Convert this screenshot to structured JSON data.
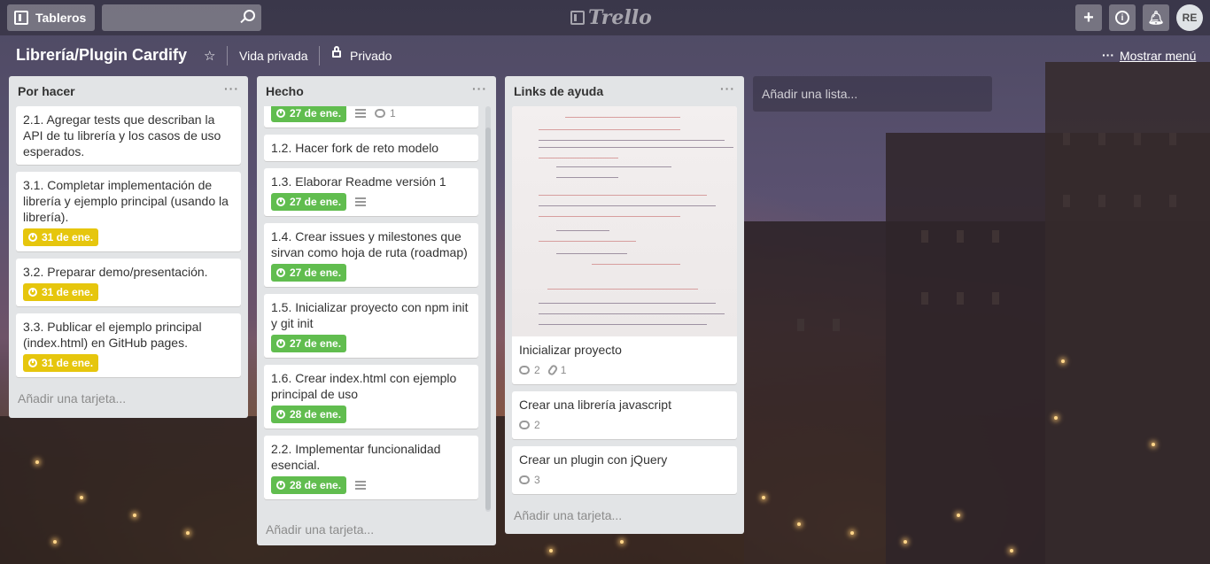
{
  "header": {
    "boards_label": "Tableros",
    "search_placeholder": "",
    "logo": "Trello",
    "avatar_initials": "RE"
  },
  "board": {
    "title": "Librería/Plugin Cardify",
    "visibility_team": "Vida privada",
    "visibility": "Privado",
    "menu_label": "Mostrar menú"
  },
  "colors": {
    "due_yellow": "#e6c60d",
    "due_green": "#61bd4f",
    "list_bg": "#e2e4e6"
  },
  "lists": [
    {
      "title": "Por hacer",
      "add_card": "Añadir una tarjeta...",
      "cards": [
        {
          "title": "2.1. Agregar tests que describan la API de tu librería y los casos de uso esperados."
        },
        {
          "title": "3.1. Completar implementación de librería y ejemplo principal (usando la librería).",
          "due": "31 de ene."
        },
        {
          "title": "3.2. Preparar demo/presentación.",
          "due": "31 de ene."
        },
        {
          "title": "3.3. Publicar el ejemplo principal (index.html) en GitHub pages.",
          "due": "31 de ene."
        }
      ]
    },
    {
      "title": "Hecho",
      "add_card": "Añadir una tarjeta...",
      "cards": [
        {
          "due": "27 de ene.",
          "comments": "1"
        },
        {
          "title": "1.2. Hacer fork de reto modelo"
        },
        {
          "title": "1.3. Elaborar Readme versión 1",
          "due": "27 de ene."
        },
        {
          "title": "1.4. Crear issues y milestones que sirvan como hoja de ruta (roadmap)",
          "due": "27 de ene."
        },
        {
          "title": "1.5. Inicializar proyecto con npm init y git init",
          "due": "27 de ene."
        },
        {
          "title": "1.6. Crear index.html con ejemplo principal de uso",
          "due": "28 de ene."
        },
        {
          "title": "2.2. Implementar funcionalidad esencial.",
          "due": "28 de ene."
        }
      ]
    },
    {
      "title": "Links de ayuda",
      "add_card": "Añadir una tarjeta...",
      "cards": [
        {
          "title": "Inicializar proyecto",
          "comments": "2",
          "attachments": "1"
        },
        {
          "title": "Crear una librería javascript",
          "comments": "2"
        },
        {
          "title": "Crear un plugin con jQuery",
          "comments": "3"
        }
      ]
    }
  ],
  "add_list": "Añadir una lista..."
}
